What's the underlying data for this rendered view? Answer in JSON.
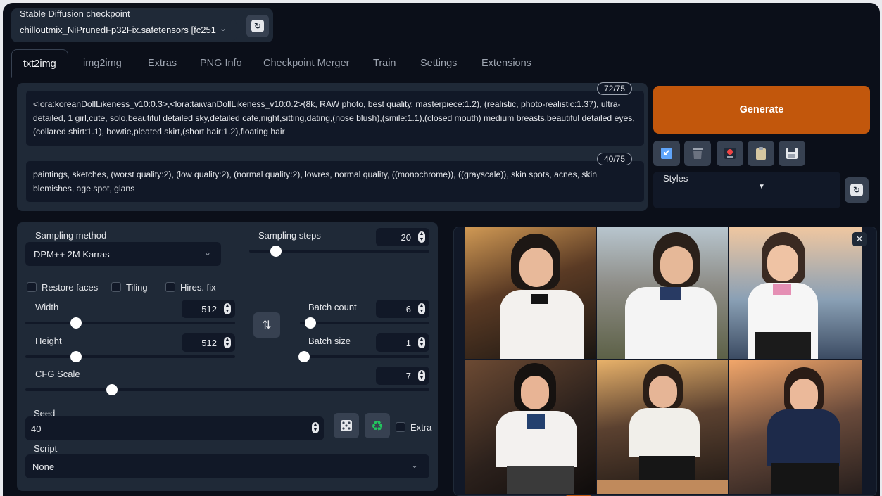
{
  "checkpoint": {
    "label": "Stable Diffusion checkpoint",
    "value": "chilloutmix_NiPrunedFp32Fix.safetensors [fc251"
  },
  "tabs": [
    {
      "label": "txt2img",
      "active": true
    },
    {
      "label": "img2img"
    },
    {
      "label": "Extras"
    },
    {
      "label": "PNG Info"
    },
    {
      "label": "Checkpoint Merger"
    },
    {
      "label": "Train"
    },
    {
      "label": "Settings"
    },
    {
      "label": "Extensions"
    }
  ],
  "prompt": {
    "token_count": "72/75",
    "text": "<lora:koreanDollLikeness_v10:0.3>,<lora:taiwanDollLikeness_v10:0.2>(8k, RAW photo, best quality, masterpiece:1.2), (realistic, photo-realistic:1.37), ultra-detailed, 1 girl,cute, solo,beautiful detailed sky,detailed cafe,night,sitting,dating,(nose blush),(smile:1.1),(closed mouth) medium breasts,beautiful detailed eyes,(collared shirt:1.1), bowtie,pleated skirt,(short hair:1.2),floating hair"
  },
  "negative_prompt": {
    "token_count": "40/75",
    "text": "paintings, sketches, (worst quality:2), (low quality:2), (normal quality:2), lowres, normal quality, ((monochrome)), ((grayscale)), skin spots, acnes, skin blemishes, age spot, glans"
  },
  "generate_label": "Generate",
  "styles_label": "Styles",
  "sampling": {
    "method_label": "Sampling method",
    "method_value": "DPM++ 2M Karras",
    "steps_label": "Sampling steps",
    "steps_value": "20"
  },
  "checkboxes": {
    "restore_faces": "Restore faces",
    "tiling": "Tiling",
    "hires_fix": "Hires. fix"
  },
  "width": {
    "label": "Width",
    "value": "512"
  },
  "height": {
    "label": "Height",
    "value": "512"
  },
  "batch_count": {
    "label": "Batch count",
    "value": "6"
  },
  "batch_size": {
    "label": "Batch size",
    "value": "1"
  },
  "cfg_scale": {
    "label": "CFG Scale",
    "value": "7"
  },
  "seed": {
    "label": "Seed",
    "value": "40",
    "extra_label": "Extra"
  },
  "script": {
    "label": "Script",
    "value": "None"
  },
  "icons": {
    "refresh": "refresh-icon",
    "swap": "swap-arrows-icon",
    "dice": "dice-icon",
    "recycle": "recycle-icon",
    "close": "close-icon",
    "tools": [
      "paste-icon",
      "trash-icon",
      "model-icon",
      "clipboard-icon",
      "save-icon"
    ]
  },
  "colors": {
    "background": "#0b0f19",
    "panel": "#1f2937",
    "accent": "#c2570c"
  }
}
